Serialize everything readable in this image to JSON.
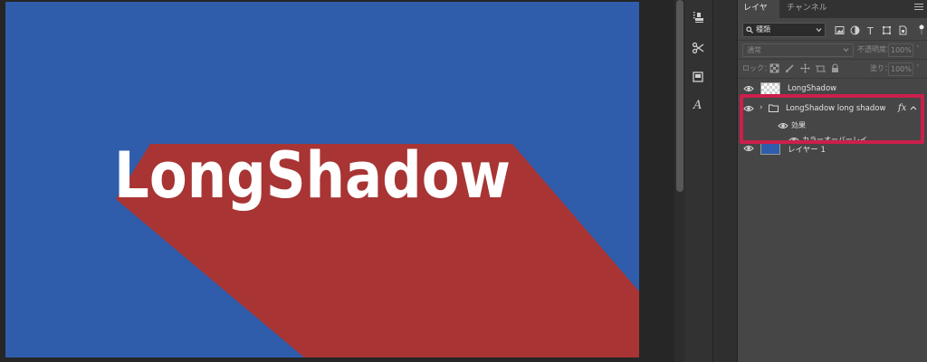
{
  "canvas": {
    "artwork_text": "LongShadow",
    "background_color": "#2f5dab",
    "shadow_color": "#a83434",
    "text_color": "#ffffff"
  },
  "layers_panel": {
    "tabs": [
      {
        "label": "レイヤー",
        "active": true
      },
      {
        "label": "チャンネル",
        "active": false
      }
    ],
    "filter": {
      "kind_label": "種類"
    },
    "blend_mode": "通常",
    "opacity_label": "不透明度：",
    "opacity_value": "100%",
    "lock_label": "ロック：",
    "fill_label": "塗り：",
    "fill_value": "100%",
    "layers": [
      {
        "name": "LongShadow",
        "type": "text-layer",
        "visible": true
      },
      {
        "name": "LongShadow long shadow",
        "type": "group",
        "visible": true,
        "fx": "fx",
        "expanded": true
      },
      {
        "name": "効果",
        "type": "effects",
        "visible": true
      },
      {
        "name": "カラーオーバーレイ",
        "type": "effect",
        "visible": true
      },
      {
        "name": "レイヤー 1",
        "type": "pixel-layer",
        "visible": true,
        "thumb_color": "#2f5dab"
      }
    ],
    "highlight_color": "#cc1f4b"
  }
}
